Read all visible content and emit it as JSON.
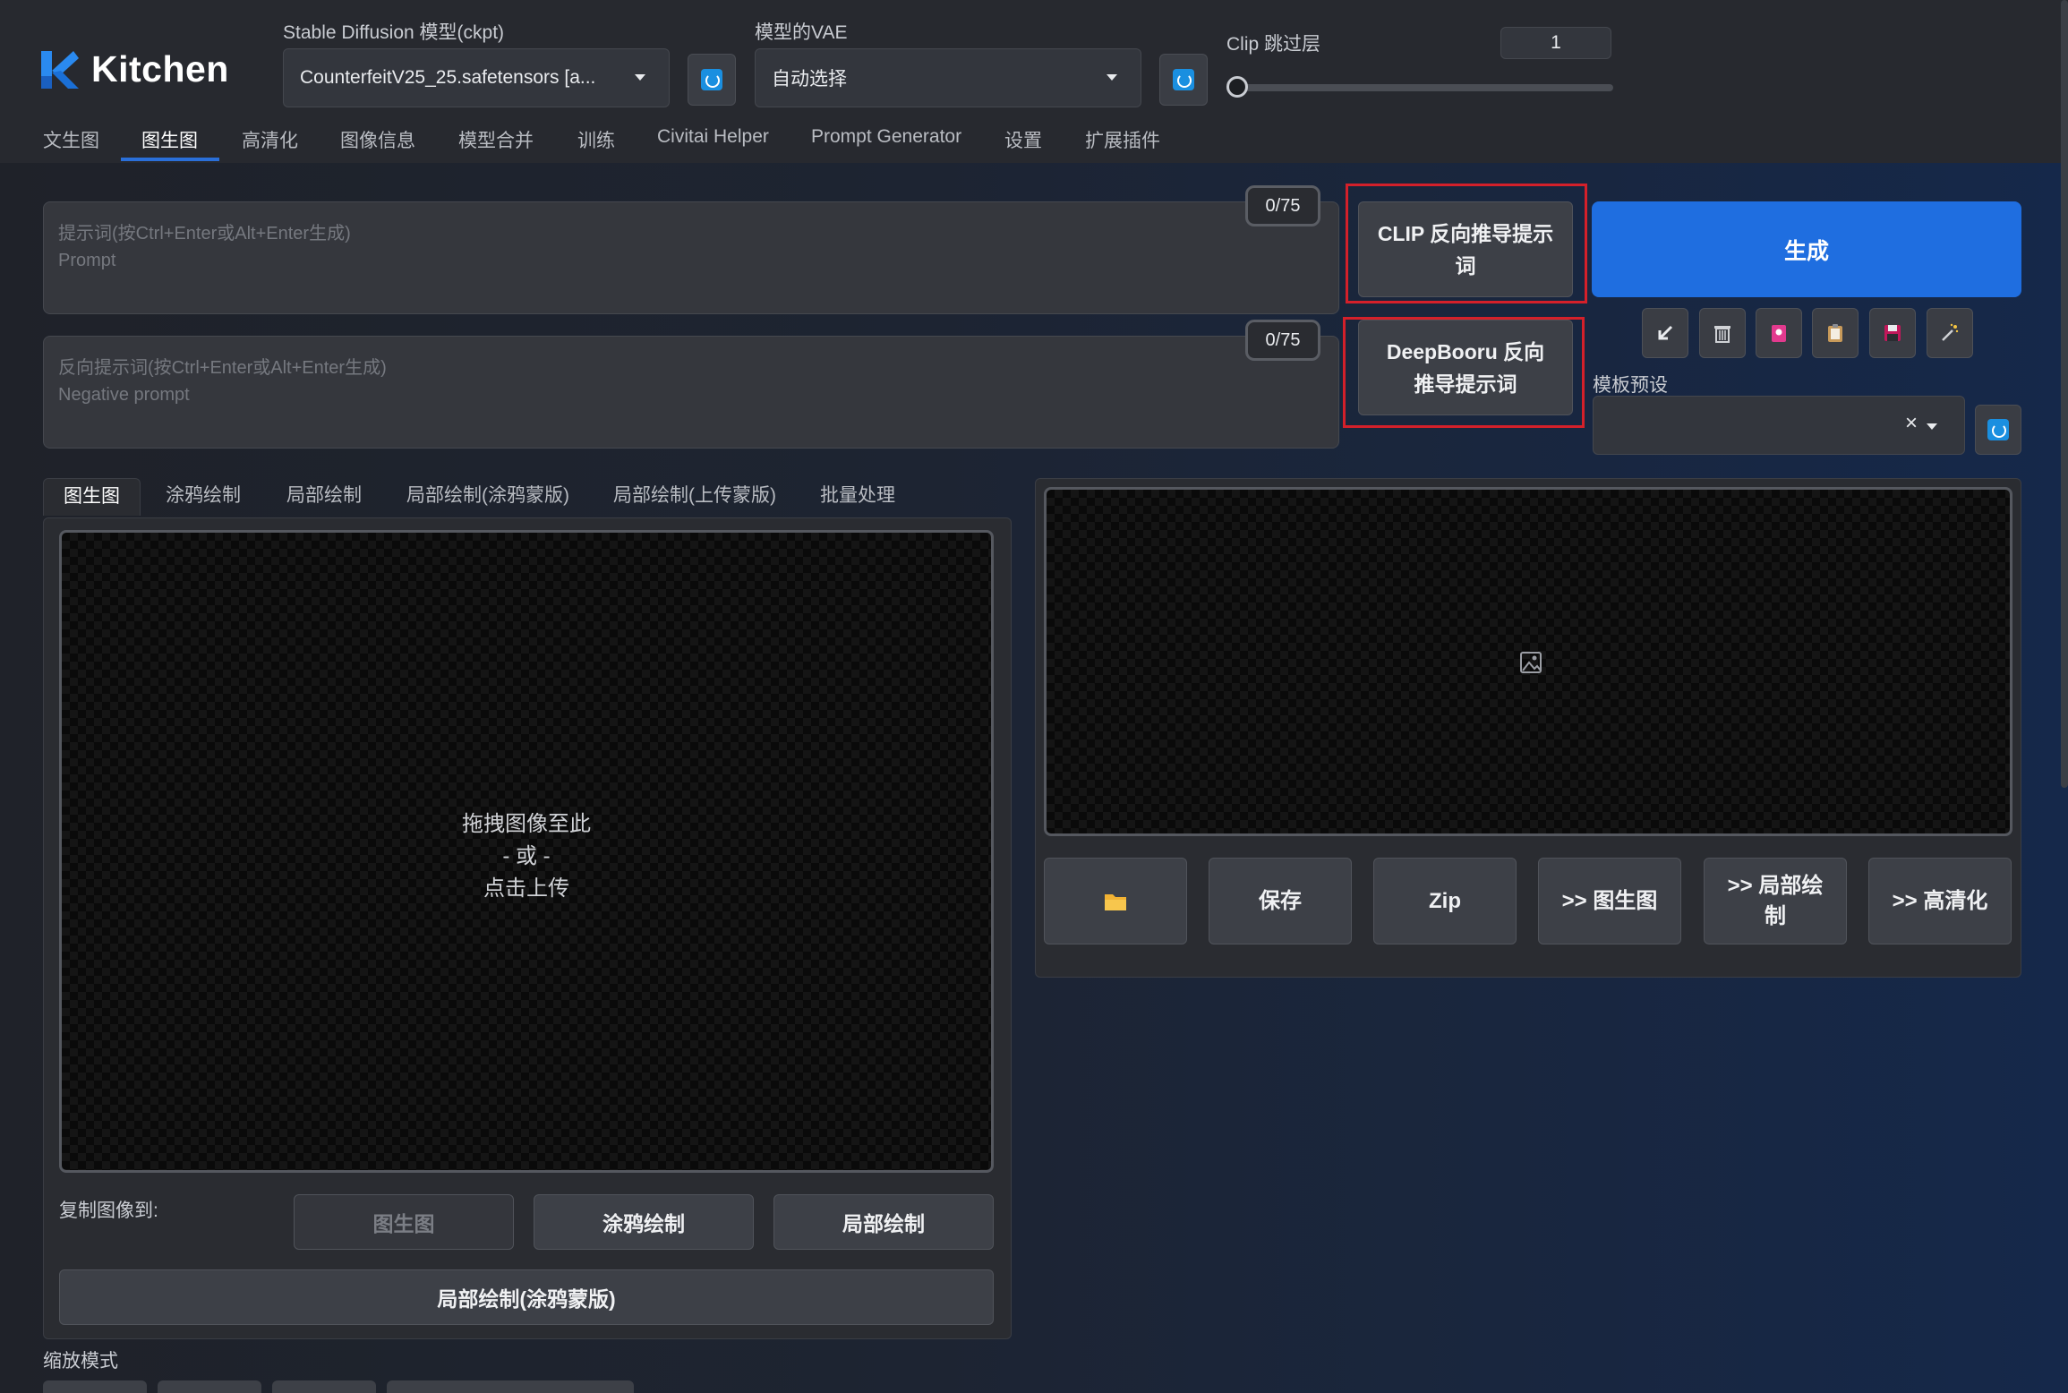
{
  "app": {
    "logo_text": "Kitchen",
    "accent_color": "#1f6ee0",
    "highlight_color": "#d4202a"
  },
  "model": {
    "label": "Stable Diffusion 模型(ckpt)",
    "value": "CounterfeitV25_25.safetensors [a..."
  },
  "vae": {
    "label": "模型的VAE",
    "value": "自动选择"
  },
  "clip_skip": {
    "label": "Clip 跳过层",
    "value": "1"
  },
  "top_tabs": [
    {
      "label": "文生图"
    },
    {
      "label": "图生图"
    },
    {
      "label": "高清化"
    },
    {
      "label": "图像信息"
    },
    {
      "label": "模型合并"
    },
    {
      "label": "训练"
    },
    {
      "label": "Civitai Helper"
    },
    {
      "label": "Prompt Generator"
    },
    {
      "label": "设置"
    },
    {
      "label": "扩展插件"
    }
  ],
  "active_top_tab": "图生图",
  "prompt": {
    "placeholder_line1": "提示词(按Ctrl+Enter或Alt+Enter生成)",
    "placeholder_line2": "Prompt",
    "counter": "0/75"
  },
  "negative_prompt": {
    "placeholder_line1": "反向提示词(按Ctrl+Enter或Alt+Enter生成)",
    "placeholder_line2": "Negative prompt",
    "counter": "0/75"
  },
  "interrogate": {
    "clip_label": "CLIP 反向推导提示词",
    "deepbooru_label": "DeepBooru 反向推导提示词"
  },
  "generate_label": "生成",
  "tool_icons": [
    "arrow-icon",
    "trash-icon",
    "card-icon",
    "clipboard-icon",
    "save-icon",
    "magic-icon"
  ],
  "preset": {
    "label": "模板预设",
    "value": "",
    "clear_glyph": "×"
  },
  "img2img_tabs": [
    {
      "label": "图生图"
    },
    {
      "label": "涂鸦绘制"
    },
    {
      "label": "局部绘制"
    },
    {
      "label": "局部绘制(涂鸦蒙版)"
    },
    {
      "label": "局部绘制(上传蒙版)"
    },
    {
      "label": "批量处理"
    }
  ],
  "upload": {
    "line1": "拖拽图像至此",
    "line2": "- 或 -",
    "line3": "点击上传"
  },
  "copy_to": {
    "label": "复制图像到:",
    "buttons": [
      "图生图",
      "涂鸦绘制",
      "局部绘制"
    ],
    "wide_button": "局部绘制(涂鸦蒙版)"
  },
  "resize_mode_label": "缩放模式",
  "output_buttons": {
    "save": "保存",
    "zip": "Zip",
    "to_img2img": ">> 图生图",
    "to_inpaint": ">> 局部绘制",
    "to_extras": ">> 高清化"
  }
}
